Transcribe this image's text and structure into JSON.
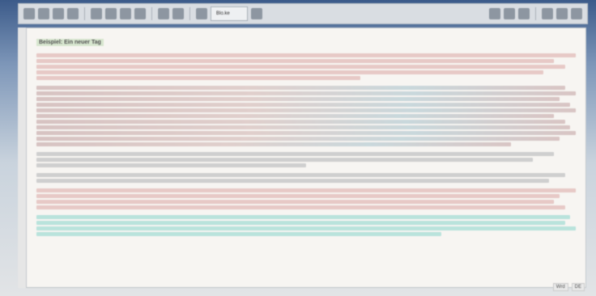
{
  "toolbar": {
    "style_value": "Blo.ke",
    "buttons_left": [
      "menu-icon",
      "bold-icon",
      "italic-icon",
      "underline-icon",
      "align-left-icon",
      "align-center-icon",
      "table-icon",
      "list-icon",
      "undo-icon",
      "redo-icon",
      "image-icon"
    ],
    "buttons_right": [
      "signal-icon",
      "refresh-icon",
      "trash-icon",
      "settings-icon",
      "minus-icon",
      "user-icon"
    ]
  },
  "document": {
    "title": "Beispiel: Ein neuer Tag",
    "paragraphs": [
      {
        "lines": [
          100,
          96,
          98,
          94,
          60
        ],
        "tone": "pink"
      },
      {
        "lines": [
          98,
          100,
          97,
          99,
          100,
          96,
          98,
          99,
          100,
          97,
          88
        ],
        "tone": "mix"
      },
      {
        "lines": [
          96,
          92,
          50
        ],
        "tone": "plain"
      },
      {
        "lines": [
          98,
          95
        ],
        "tone": "plain"
      },
      {
        "lines": [
          100,
          97,
          96,
          98
        ],
        "tone": "pink"
      },
      {
        "lines": [
          99,
          98,
          100,
          75
        ],
        "tone": "teal"
      }
    ]
  },
  "status": {
    "word_count": "Wrd",
    "lang": "DE"
  }
}
